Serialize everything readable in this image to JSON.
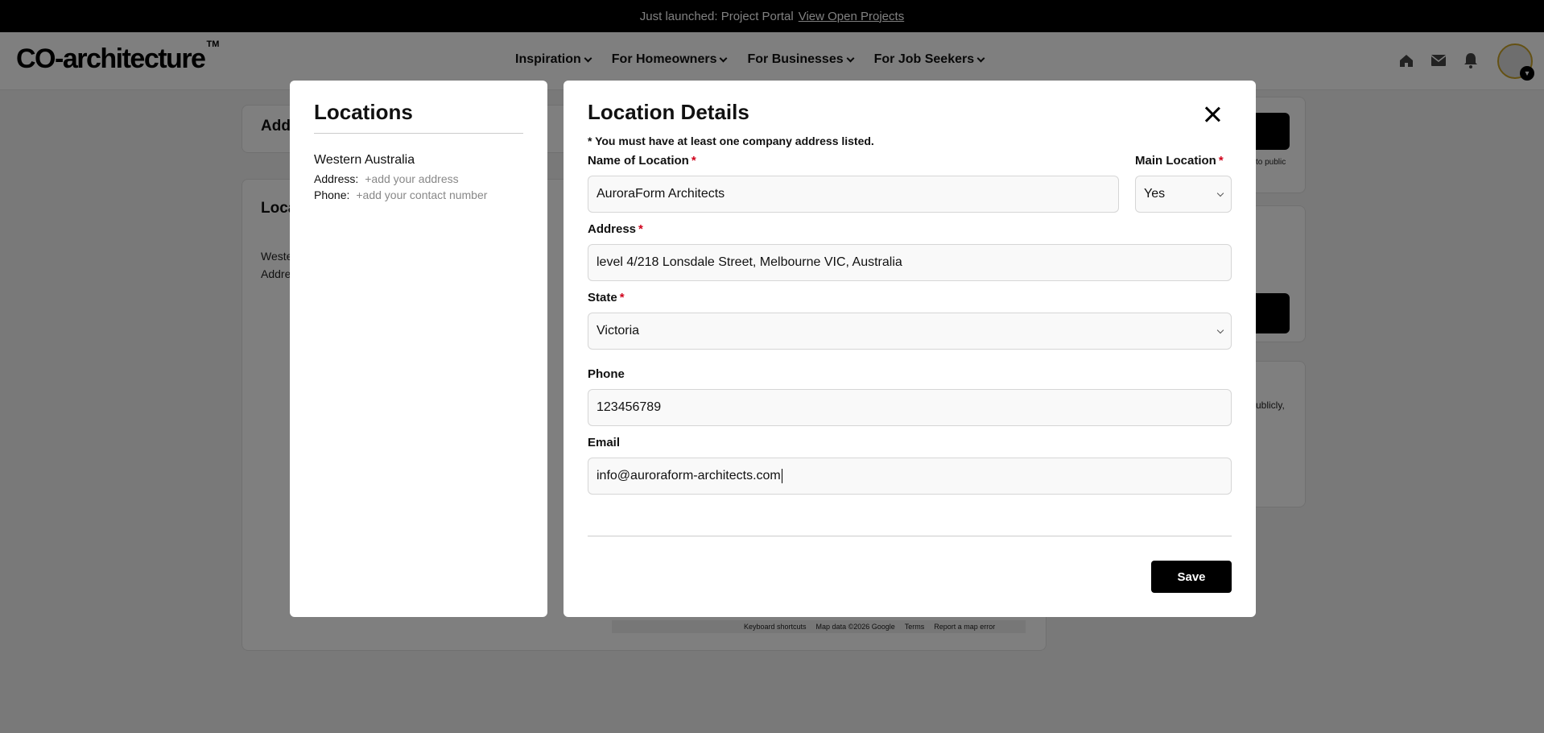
{
  "announcement": {
    "text": "Just launched: Project Portal",
    "link": "View Open Projects"
  },
  "header": {
    "logo": "CO-architecture",
    "logo_mark": "TM",
    "nav": [
      {
        "label": "Inspiration"
      },
      {
        "label": "For Homeowners"
      },
      {
        "label": "For Businesses"
      },
      {
        "label": "For Job Seekers"
      }
    ],
    "icons": [
      "home-icon",
      "mail-icon",
      "bell-icon"
    ]
  },
  "background": {
    "card1_title": "Add",
    "card2_title": "Loca",
    "card2_line1": "Weste",
    "card2_line2": "Addre",
    "right_note1": "to public",
    "right_note2": "ublicly,",
    "map_footer": {
      "shortcuts": "Keyboard shortcuts",
      "map_data": "Map data ©2026 Google",
      "terms": "Terms",
      "report": "Report a map error"
    }
  },
  "locations_modal": {
    "title": "Locations",
    "entries": [
      {
        "name": "Western Australia",
        "address_label": "Address:",
        "address_value": "+add your address",
        "phone_label": "Phone:",
        "phone_value": "+add your contact number"
      }
    ]
  },
  "details_modal": {
    "title": "Location Details",
    "note": "* You must have at least one company address listed.",
    "required_mark": "*",
    "name_label": "Name of Location",
    "name_value": "AuroraForm Architects",
    "main_label": "Main Location",
    "main_value": "Yes",
    "address_label": "Address",
    "address_value": "level 4/218 Lonsdale Street, Melbourne VIC, Australia",
    "state_label": "State",
    "state_value": "Victoria",
    "phone_label": "Phone",
    "phone_value": "123456789",
    "email_label": "Email",
    "email_value": "info@auroraform-architects.com",
    "save_label": "Save"
  },
  "colors": {
    "accent": "#000000",
    "required": "#d0011b",
    "overlay": "#808080"
  }
}
